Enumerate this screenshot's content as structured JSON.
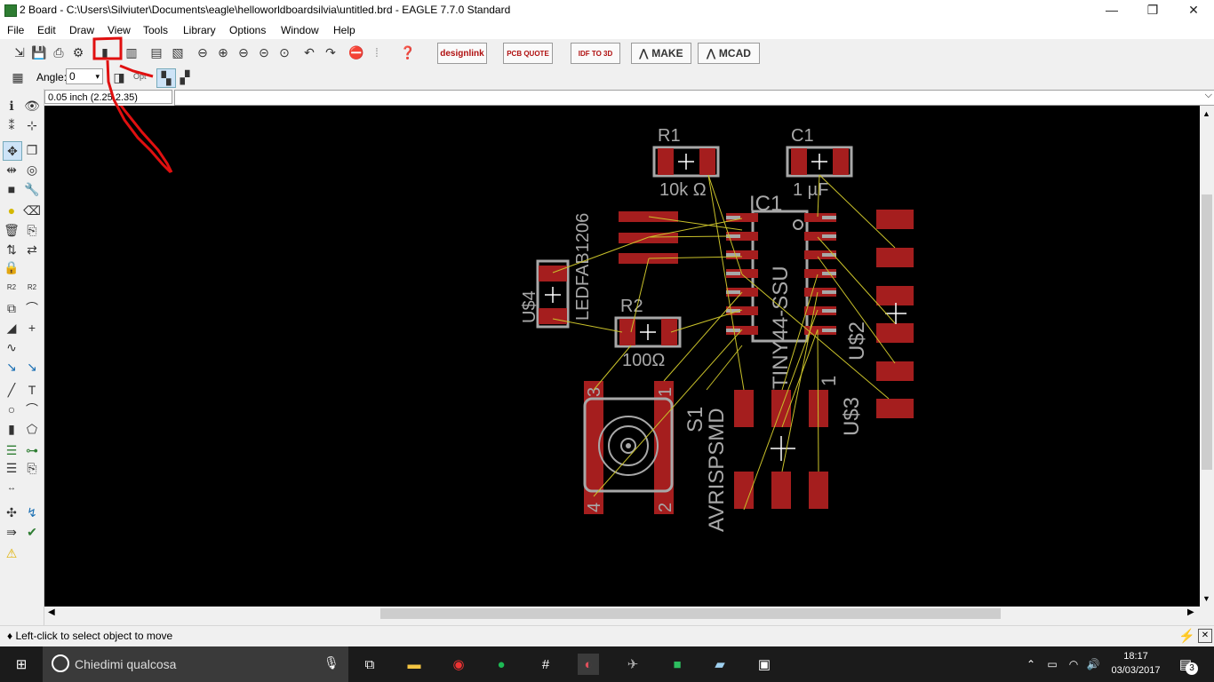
{
  "window": {
    "title": "2 Board - C:\\Users\\Silviuter\\Documents\\eagle\\helloworldboardsilvia\\untitled.brd - EAGLE 7.7.0 Standard",
    "minimize": "—",
    "maximize": "❐",
    "close": "✕"
  },
  "menu": [
    "File",
    "Edit",
    "Draw",
    "View",
    "Tools",
    "Library",
    "Options",
    "Window",
    "Help"
  ],
  "toolbar": {
    "buttons": {
      "designlink": "designlink",
      "pcb_quote": "PCB QUOTE",
      "idf": "IDF TO 3D",
      "make": "MAKE",
      "mcad": "MCAD"
    }
  },
  "params": {
    "angle_label": "Angle:",
    "angle_value": "0",
    "opt_label": "Opt"
  },
  "coord": {
    "readout": "0.05 inch (2.25 2.35)"
  },
  "board": {
    "r1": {
      "name": "R1",
      "value": "10k Ω"
    },
    "c1": {
      "name": "C1",
      "value": "1 µF"
    },
    "ic1": {
      "name": "IC1",
      "value": "ATTINY44-SSU"
    },
    "u4": {
      "name": "U$4",
      "value": "LEDFAB1206"
    },
    "r2": {
      "name": "R2",
      "value": "100Ω"
    },
    "s1": {
      "name": "S1",
      "pin1": "1",
      "pin2": "2",
      "pin3": "3",
      "pin4": "4"
    },
    "avr": {
      "value": "AVRISPSMD",
      "pin1": "1"
    },
    "u2": {
      "name": "U$2"
    },
    "u3": {
      "name": "U$3"
    }
  },
  "colors": {
    "pad": "#a51e1e",
    "silk": "#a8a8a8",
    "airwire": "#c9c12a",
    "annotation": "#e01010"
  },
  "status": {
    "hint": "♦ Left-click to select object to move"
  },
  "taskbar": {
    "search_placeholder": "Chiedimi qualcosa",
    "time": "18:17",
    "date": "03/03/2017",
    "notification_count": "3"
  }
}
